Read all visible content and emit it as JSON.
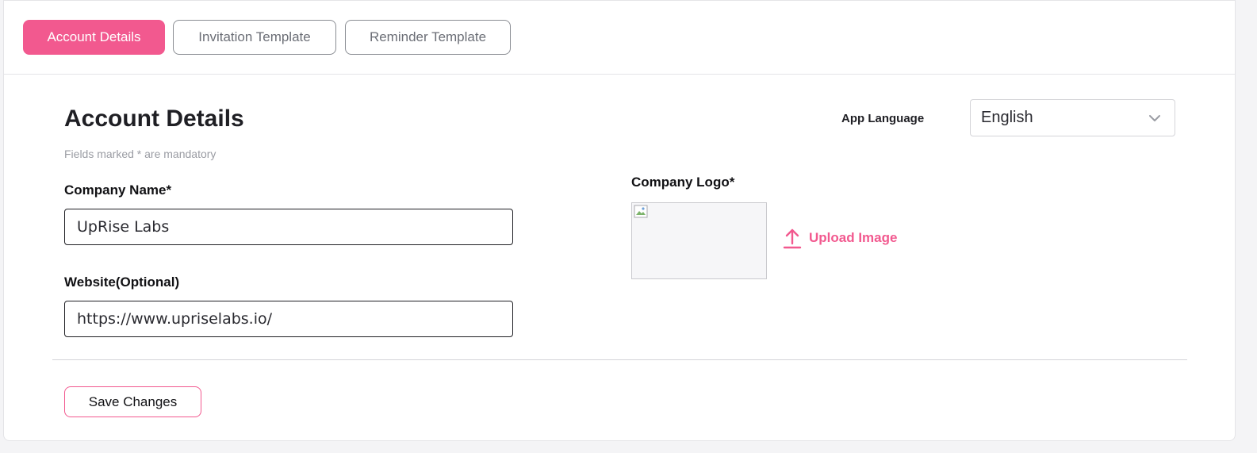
{
  "tabs": [
    {
      "label": "Account Details",
      "active": true
    },
    {
      "label": "Invitation Template",
      "active": false
    },
    {
      "label": "Reminder Template",
      "active": false
    }
  ],
  "page": {
    "title": "Account Details",
    "subtitle": "Fields marked * are mandatory"
  },
  "language": {
    "label": "App Language",
    "selected": "English",
    "icon": "chevron-down-icon"
  },
  "form": {
    "company_name": {
      "label": "Company Name*",
      "value": "UpRise Labs"
    },
    "website": {
      "label": "Website(Optional)",
      "value": "https://www.upriselabs.io/"
    },
    "logo": {
      "label": "Company Logo*",
      "upload_label": "Upload Image",
      "icon": "upload-icon"
    }
  },
  "actions": {
    "save_label": "Save Changes"
  },
  "colors": {
    "accent": "#f2598f",
    "text": "#1f1f24",
    "muted": "#9a9ca3",
    "border": "#e4e4e7"
  }
}
